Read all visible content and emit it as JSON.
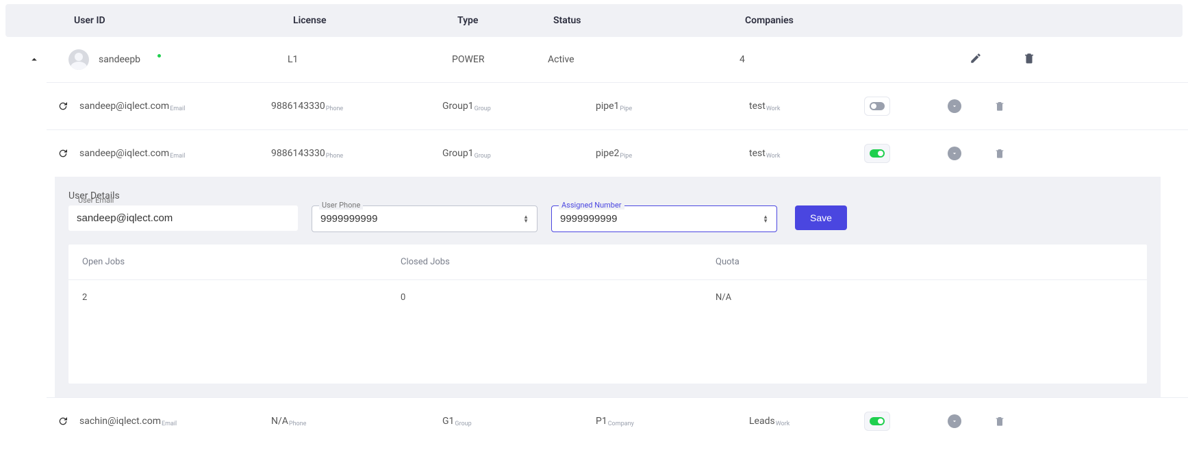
{
  "headers": {
    "user_id": "User ID",
    "license": "License",
    "type": "Type",
    "status": "Status",
    "companies": "Companies"
  },
  "main_user": {
    "name": "sandeepb",
    "license": "L1",
    "type": "POWER",
    "status": "Active",
    "companies": "4"
  },
  "sub_labels": {
    "email": "Email",
    "phone": "Phone",
    "group": "Group",
    "pipe": "Pipe",
    "work": "Work",
    "company": "Company"
  },
  "subs": [
    {
      "email": "sandeep@iqlect.com",
      "phone": "9886143330",
      "group": "Group1",
      "pipe": "pipe1",
      "work": "test",
      "toggle": "off"
    },
    {
      "email": "sandeep@iqlect.com",
      "phone": "9886143330",
      "group": "Group1",
      "pipe": "pipe2",
      "work": "test",
      "toggle": "on"
    }
  ],
  "details": {
    "title": "User Details",
    "email_label": "User Email",
    "email_value": "sandeep@iqlect.com",
    "phone_label": "User Phone",
    "phone_value": "9999999999",
    "assigned_label": "Assigned Number",
    "assigned_value": "9999999999",
    "save": "Save"
  },
  "jobs": {
    "headers": {
      "open": "Open Jobs",
      "closed": "Closed Jobs",
      "quota": "Quota"
    },
    "row": {
      "open": "2",
      "closed": "0",
      "quota": "N/A"
    }
  },
  "other_user": {
    "email": "sachin@iqlect.com",
    "phone": "N/A",
    "group": "G1",
    "pipe": "P1",
    "pipe_label": "Company",
    "work": "Leads",
    "toggle": "on"
  }
}
